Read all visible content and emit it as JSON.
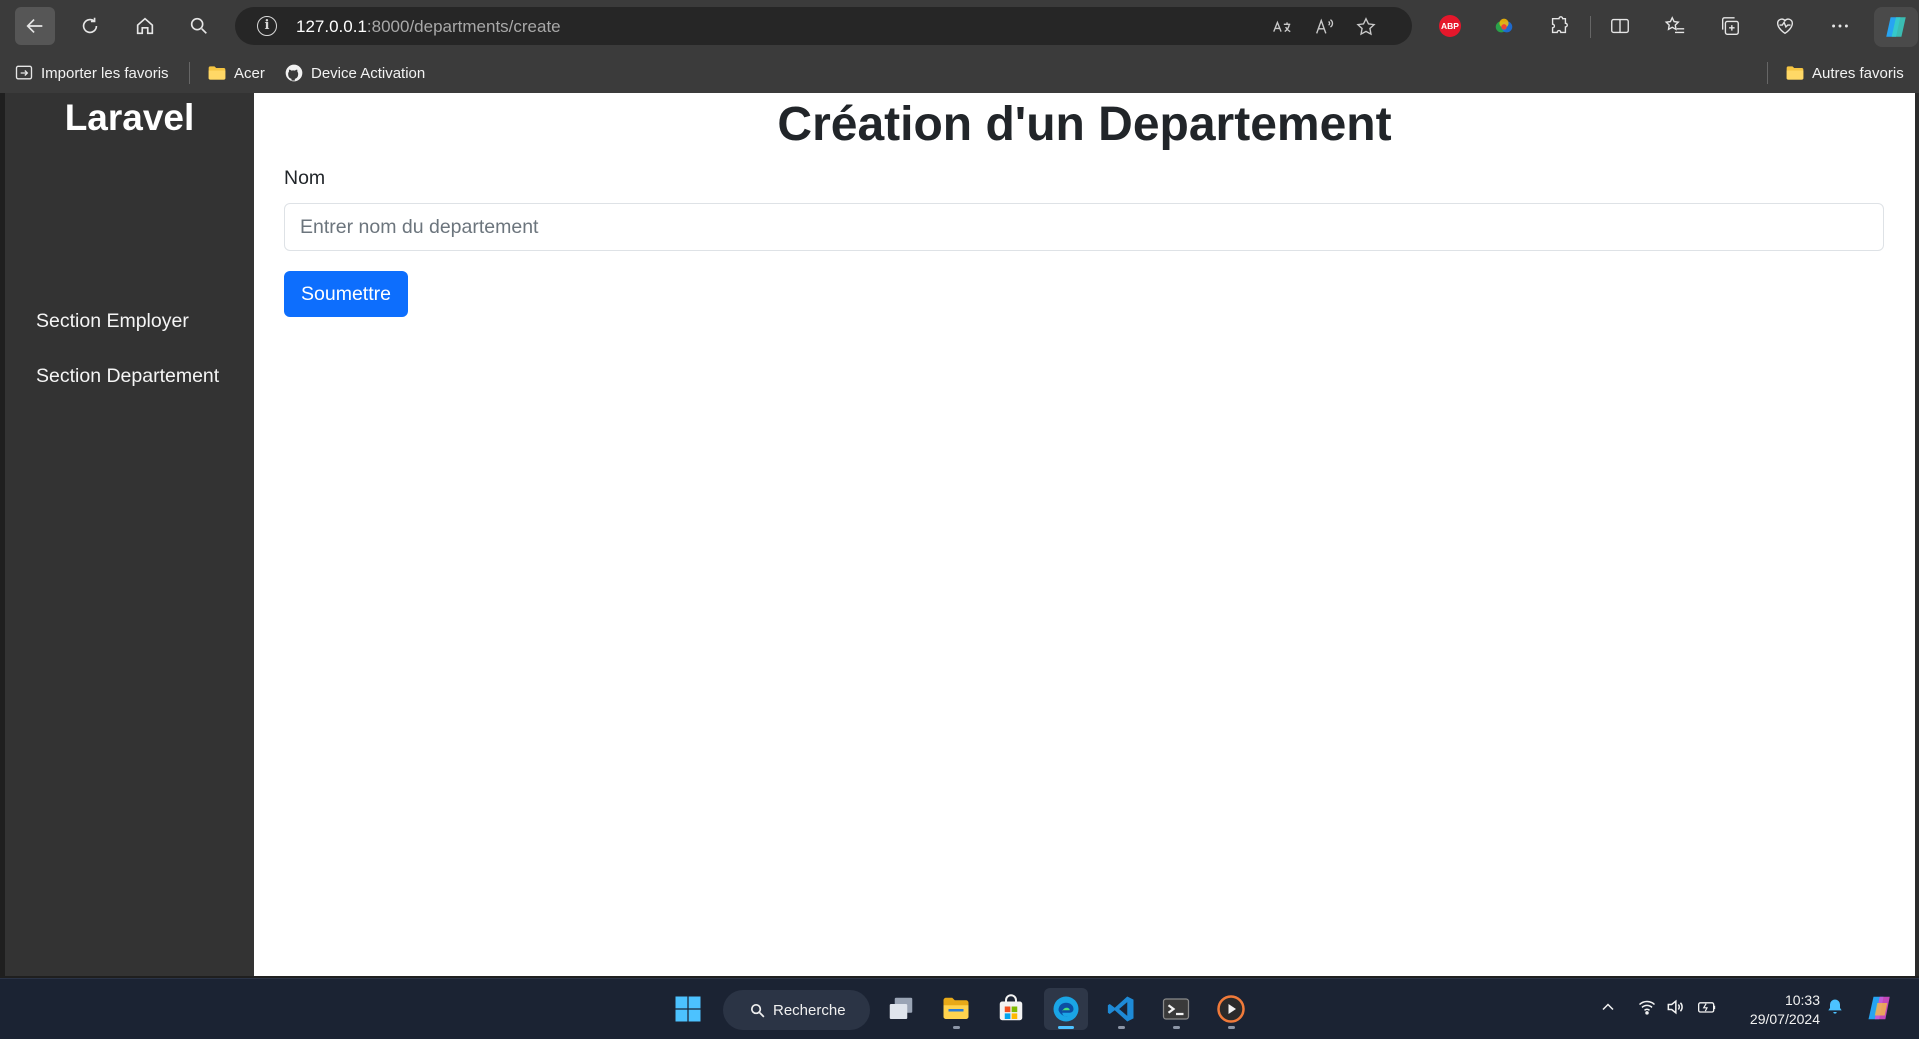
{
  "browser": {
    "url_host": "127.0.0.1",
    "url_path": ":8000/departments/create",
    "translate_icon": "translate-icon",
    "read_aloud_icon": "read-aloud-icon",
    "abp_label": "ABP"
  },
  "favorites": {
    "import_label": "Importer les favoris",
    "folder_acer": "Acer",
    "device_activation": "Device Activation",
    "other_favorites": "Autres favoris"
  },
  "sidebar": {
    "brand": "Laravel",
    "items": [
      {
        "label": "Section Employer"
      },
      {
        "label": "Section Departement"
      }
    ]
  },
  "main": {
    "title": "Création d'un Departement",
    "field_label": "Nom",
    "input_value": "",
    "input_placeholder": "Entrer nom du departement",
    "submit_label": "Soumettre"
  },
  "taskbar": {
    "search_label": "Recherche",
    "time": "10:33",
    "date": "29/07/2024"
  },
  "colors": {
    "primary_button": "#0d6efd",
    "sidebar_bg": "#333333",
    "chrome_bg": "#3b3b3b",
    "taskbar_bg": "#1b2333"
  }
}
